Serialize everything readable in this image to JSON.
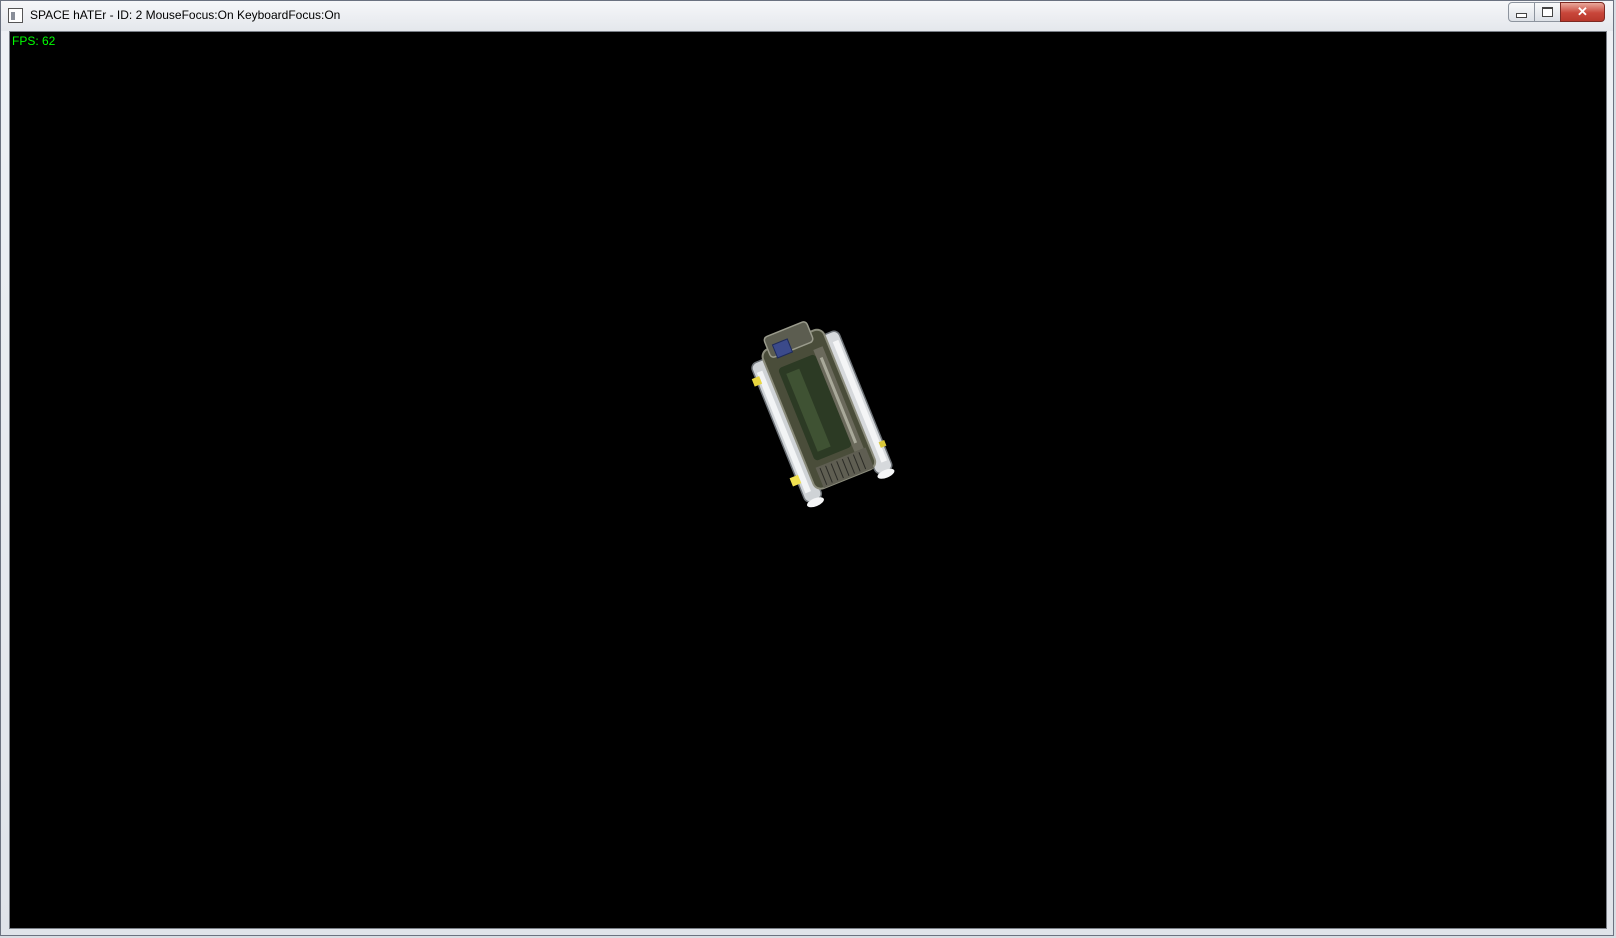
{
  "window": {
    "title": "SPACE hATEr - ID: 2 MouseFocus:On KeyboardFocus:On",
    "icon": "app-window-icon",
    "controls": {
      "minimize_icon": "minimize-icon",
      "maximize_icon": "maximize-icon",
      "close_label": "✕"
    }
  },
  "hud": {
    "fps_text": "FPS: 62",
    "fps_color": "#00ff00"
  },
  "scene": {
    "background_color": "#000000",
    "object": "spaceship-model"
  }
}
